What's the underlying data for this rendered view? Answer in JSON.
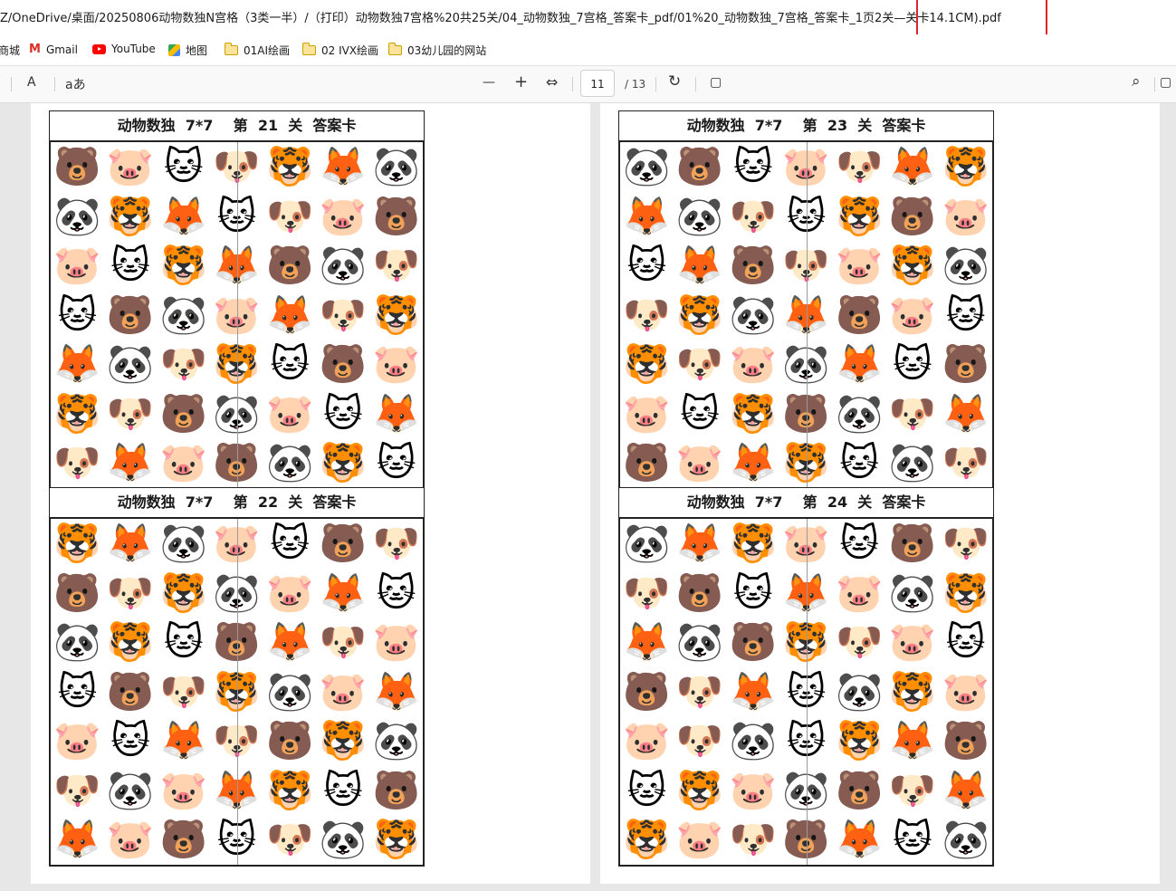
{
  "address_bar": {
    "url": "Z/OneDrive/桌面/20250806动物数独N宫格（3类一半）/（打印）动物数独7宫格%20共25关/04_动物数独_7宫格_答案卡_pdf/01%20_动物数独_7宫格_答案卡_1页2关—关卡14.1CM).pdf"
  },
  "bookmarks": [
    {
      "label": "商城"
    },
    {
      "label": "Gmail",
      "icon": "gmail-icon"
    },
    {
      "label": "YouTube",
      "icon": "youtube-icon"
    },
    {
      "label": "地图",
      "icon": "maps-icon"
    },
    {
      "label": "01AI绘画",
      "icon": "folder-icon"
    },
    {
      "label": "02 IVX绘画",
      "icon": "folder-icon"
    },
    {
      "label": "03幼儿园的网站",
      "icon": "folder-icon"
    }
  ],
  "toolbar": {
    "read_aloud": "A",
    "translate": "aあ",
    "zoom_out": "—",
    "zoom_in": "+",
    "fit": "⇔",
    "current_page": "11",
    "total_pages": "/ 13",
    "rotate": "↻",
    "page_view": "▢",
    "search": "⌕",
    "more": "▢"
  },
  "animal_glyphs": {
    "bear": "🐻",
    "pig": "🐷",
    "cat": "🐱",
    "dog": "🐶",
    "tiger": "🐯",
    "fox": "🦊",
    "panda": "🐼"
  },
  "cards": [
    {
      "title": "动物数独  7*7    第  21  关  答案卡",
      "grid": [
        [
          "🐻",
          "🐷",
          "🐱",
          "🐶",
          "🐯",
          "🦊",
          "🐼"
        ],
        [
          "🐼",
          "🐯",
          "🦊",
          "🐱",
          "🐶",
          "🐷",
          "🐻"
        ],
        [
          "🐷",
          "🐱",
          "🐯",
          "🦊",
          "🐻",
          "🐼",
          "🐶"
        ],
        [
          "🐱",
          "🐻",
          "🐼",
          "🐷",
          "🦊",
          "🐶",
          "🐯"
        ],
        [
          "🦊",
          "🐼",
          "🐶",
          "🐯",
          "🐱",
          "🐻",
          "🐷"
        ],
        [
          "🐯",
          "🐶",
          "🐻",
          "🐼",
          "🐷",
          "🐱",
          "🦊"
        ],
        [
          "🐶",
          "🦊",
          "🐷",
          "🐻",
          "🐼",
          "🐯",
          "🐱"
        ]
      ]
    },
    {
      "title": "动物数独  7*7    第  22  关  答案卡",
      "grid": [
        [
          "🐯",
          "🦊",
          "🐼",
          "🐷",
          "🐱",
          "🐻",
          "🐶"
        ],
        [
          "🐻",
          "🐶",
          "🐯",
          "🐼",
          "🐷",
          "🦊",
          "🐱"
        ],
        [
          "🐼",
          "🐯",
          "🐱",
          "🐻",
          "🦊",
          "🐶",
          "🐷"
        ],
        [
          "🐱",
          "🐻",
          "🐶",
          "🐯",
          "🐼",
          "🐷",
          "🦊"
        ],
        [
          "🐷",
          "🐱",
          "🦊",
          "🐶",
          "🐻",
          "🐯",
          "🐼"
        ],
        [
          "🐶",
          "🐼",
          "🐷",
          "🦊",
          "🐯",
          "🐱",
          "🐻"
        ],
        [
          "🦊",
          "🐷",
          "🐻",
          "🐱",
          "🐶",
          "🐼",
          "🐯"
        ]
      ]
    },
    {
      "title": "动物数独  7*7    第  23  关  答案卡",
      "grid": [
        [
          "🐼",
          "🐻",
          "🐱",
          "🐷",
          "🐶",
          "🦊",
          "🐯"
        ],
        [
          "🦊",
          "🐼",
          "🐶",
          "🐱",
          "🐯",
          "🐻",
          "🐷"
        ],
        [
          "🐱",
          "🦊",
          "🐻",
          "🐶",
          "🐷",
          "🐯",
          "🐼"
        ],
        [
          "🐶",
          "🐯",
          "🐼",
          "🦊",
          "🐻",
          "🐷",
          "🐱"
        ],
        [
          "🐯",
          "🐶",
          "🐷",
          "🐼",
          "🦊",
          "🐱",
          "🐻"
        ],
        [
          "🐷",
          "🐱",
          "🐯",
          "🐻",
          "🐼",
          "🐶",
          "🦊"
        ],
        [
          "🐻",
          "🐷",
          "🦊",
          "🐯",
          "🐱",
          "🐼",
          "🐶"
        ]
      ]
    },
    {
      "title": "动物数独  7*7    第  24  关  答案卡",
      "grid": [
        [
          "🐼",
          "🦊",
          "🐯",
          "🐷",
          "🐱",
          "🐻",
          "🐶"
        ],
        [
          "🐶",
          "🐻",
          "🐱",
          "🦊",
          "🐷",
          "🐼",
          "🐯"
        ],
        [
          "🦊",
          "🐼",
          "🐻",
          "🐯",
          "🐶",
          "🐷",
          "🐱"
        ],
        [
          "🐻",
          "🐶",
          "🦊",
          "🐱",
          "🐼",
          "🐯",
          "🐷"
        ],
        [
          "🐷",
          "🐶",
          "🐼",
          "🐱",
          "🐯",
          "🦊",
          "🐻"
        ],
        [
          "🐱",
          "🐯",
          "🐷",
          "🐼",
          "🐻",
          "🐶",
          "🦊"
        ],
        [
          "🐯",
          "🐷",
          "🐶",
          "🐻",
          "🦊",
          "🐱",
          "🐼"
        ]
      ]
    }
  ]
}
